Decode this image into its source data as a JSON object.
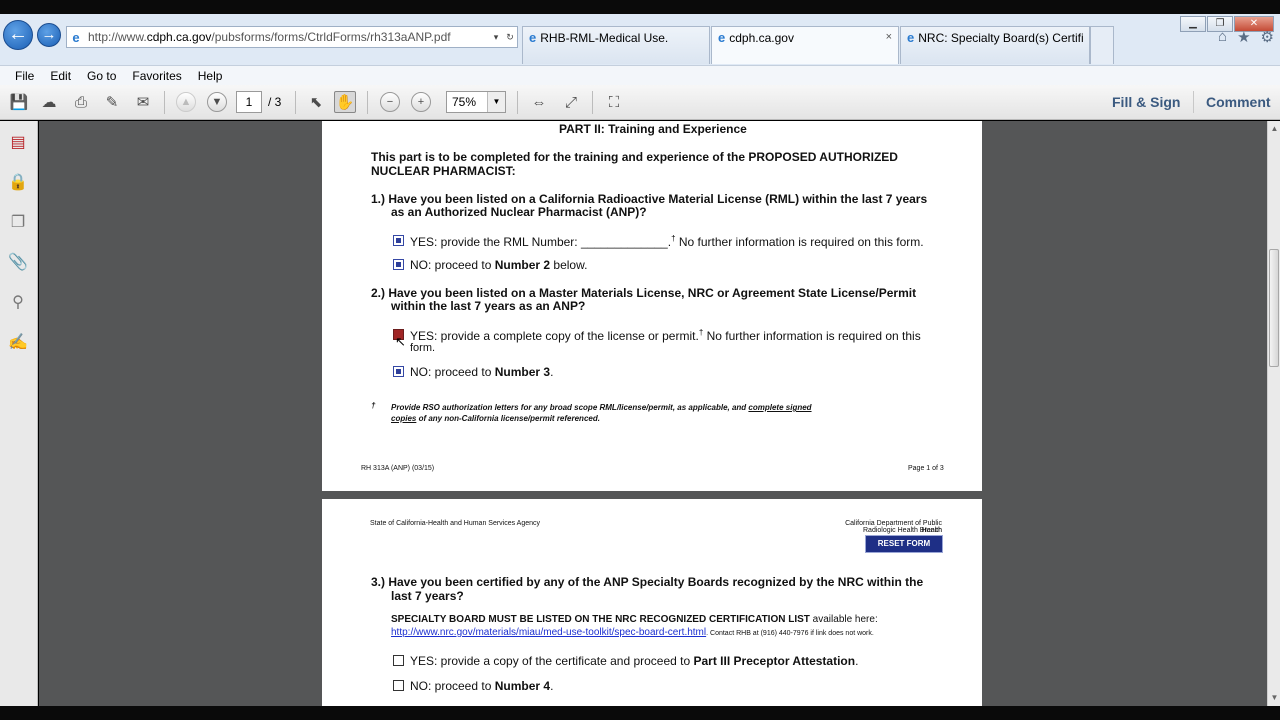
{
  "browser": {
    "address_url": "http://www.cdph.ca.gov/pubsforms/forms/CtrldForms/rh313aANP.pdf",
    "tabs": [
      {
        "label": "RHB-RML-Medical Use."
      },
      {
        "label": "cdph.ca.gov"
      },
      {
        "label": "NRC: Specialty Board(s) Certifi..."
      }
    ],
    "tab_close": "×",
    "menu": [
      "File",
      "Edit",
      "Go to",
      "Favorites",
      "Help"
    ]
  },
  "acrobat": {
    "page_current": "1",
    "page_total": "/ 3",
    "zoom": "75%",
    "fill_sign": "Fill & Sign",
    "comment": "Comment"
  },
  "page1": {
    "heading": "PART II: Training and Experience",
    "intro_line1": "This part is to be completed for the training and experience of the PROPOSED AUTHORIZED",
    "intro_line2": "NUCLEAR PHARMACIST:",
    "q1_line1": "1.)  Have you been listed on a California Radioactive Material License (RML) within the last 7 years",
    "q1_line2": "as an Authorized Nuclear Pharmacist (ANP)?",
    "q1_yes": "YES: provide the RML Number: _____________.",
    "q1_yes_dagger": "†",
    "q1_yes_tail": " No further information is required on this form.",
    "q1_no_pre": "NO: proceed to ",
    "q1_no_bold": "Number 2",
    "q1_no_post": " below.",
    "q2_line1": "2.)  Have you been listed on a Master Materials License, NRC or Agreement State License/Permit",
    "q2_line2": "within the last 7 years as an ANP?",
    "q2_yes_line1": "YES: provide a complete copy of the license or permit.",
    "q2_yes_dagger": "†",
    "q2_yes_tail": " No further information is required on this",
    "q2_yes_line2": "form.",
    "q2_no_pre": "NO: proceed to ",
    "q2_no_bold": "Number 3",
    "q2_no_post": ".",
    "footnote_mark": "†",
    "footnote_line1_pre": "Provide RSO authorization letters for any broad scope RML/license/permit, as applicable, and ",
    "footnote_line1_u": "complete signed",
    "footnote_line2_u": "copies",
    "footnote_line2_post": " of any non-California license/permit referenced.",
    "footer_left": "RH 313A (ANP) (03/15)",
    "footer_right": "Page 1 of 3"
  },
  "page2": {
    "agency_left": "State of California-Health and Human Services Agency",
    "agency_right_line1": "California Department of Public Health",
    "agency_right_line2": "Radiologic Health Branch",
    "reset_label": "RESET FORM",
    "q3_line1": "3.)  Have you been certified by any of the ANP Specialty Boards recognized by the NRC within the",
    "q3_line2": "last 7 years?",
    "specialty_bold": "SPECIALTY BOARD MUST BE LISTED ON THE NRC RECOGNIZED CERTIFICATION LIST",
    "specialty_tail": " available here:",
    "link": "http://www.nrc.gov/materials/miau/med-use-toolkit/spec-board-cert.html",
    "contact": ". Contact RHB at (916) 440-7976 if link does not work.",
    "q3_yes_pre": "YES: provide a copy of the certificate and proceed to ",
    "q3_yes_bold": "Part III Preceptor Attestation",
    "q3_yes_post": ".",
    "q3_no_pre": "NO: proceed to ",
    "q3_no_bold": "Number 4",
    "q3_no_post": "."
  }
}
